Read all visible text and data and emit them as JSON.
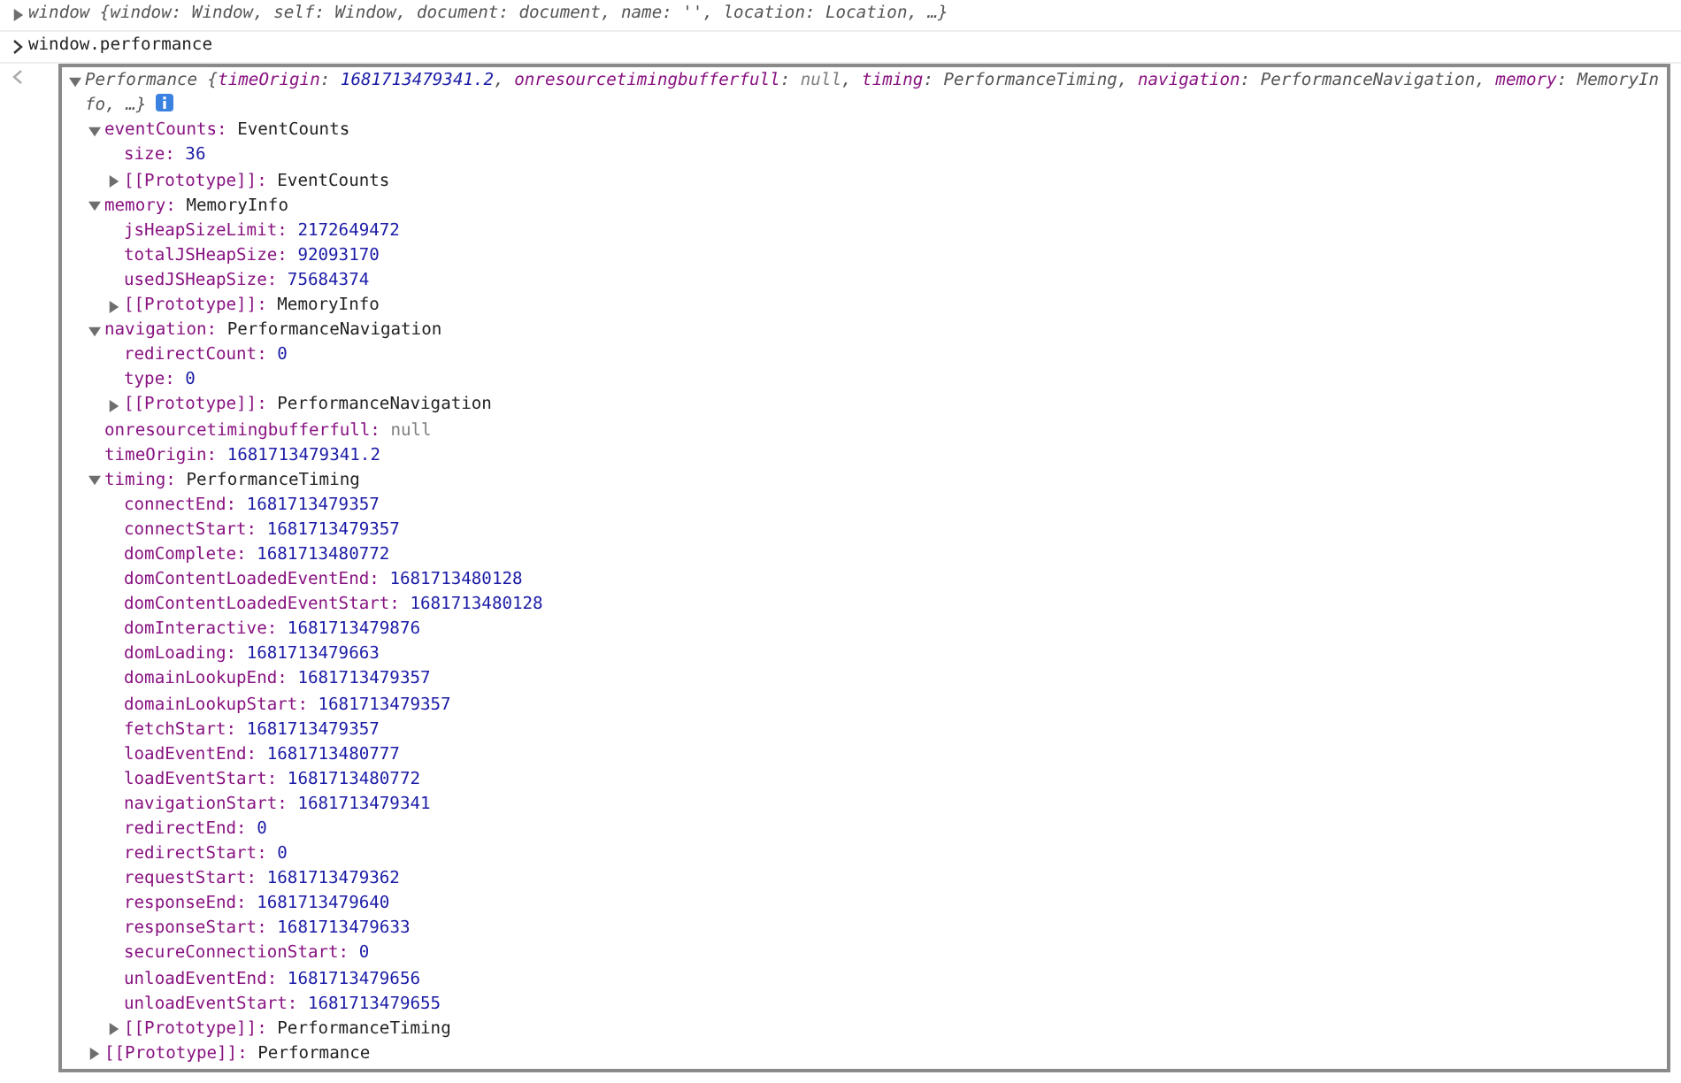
{
  "previous_entry": {
    "text": "window {window: Window, self: Window, document: document, name: '', location: Location, …}",
    "expanded": false
  },
  "input": {
    "text": "window.performance"
  },
  "result": {
    "expanded": true,
    "summary": [
      {
        "text": "Performance {",
        "kind": "plain"
      },
      {
        "text": "timeOrigin",
        "kind": "key"
      },
      {
        "text": ": ",
        "kind": "plain"
      },
      {
        "text": "1681713479341.2",
        "kind": "number"
      },
      {
        "text": ", ",
        "kind": "plain"
      },
      {
        "text": "onresourcetimingbufferfull",
        "kind": "key"
      },
      {
        "text": ": ",
        "kind": "plain"
      },
      {
        "text": "null",
        "kind": "null"
      },
      {
        "text": ", ",
        "kind": "plain"
      },
      {
        "text": "timing",
        "kind": "key"
      },
      {
        "text": ": PerformanceTiming, ",
        "kind": "plain"
      },
      {
        "text": "navigation",
        "kind": "key"
      },
      {
        "text": ": PerformanceNavigation, ",
        "kind": "plain"
      },
      {
        "text": "memory",
        "kind": "key"
      },
      {
        "text": ": MemoryInfo, …}",
        "kind": "plain"
      }
    ],
    "children": [
      {
        "key": "eventCounts:",
        "value": "EventCounts",
        "kind": "object",
        "expanded": true,
        "children": [
          {
            "key": "size:",
            "value": "36",
            "kind": "number"
          },
          {
            "key": "[[Prototype]]:",
            "value": "EventCounts",
            "kind": "object",
            "expanded": false
          }
        ]
      },
      {
        "key": "memory:",
        "value": "MemoryInfo",
        "kind": "object",
        "expanded": true,
        "children": [
          {
            "key": "jsHeapSizeLimit:",
            "value": "2172649472",
            "kind": "number"
          },
          {
            "key": "totalJSHeapSize:",
            "value": "92093170",
            "kind": "number"
          },
          {
            "key": "usedJSHeapSize:",
            "value": "75684374",
            "kind": "number"
          },
          {
            "key": "[[Prototype]]:",
            "value": "MemoryInfo",
            "kind": "object",
            "expanded": false
          }
        ]
      },
      {
        "key": "navigation:",
        "value": "PerformanceNavigation",
        "kind": "object",
        "expanded": true,
        "children": [
          {
            "key": "redirectCount:",
            "value": "0",
            "kind": "number"
          },
          {
            "key": "type:",
            "value": "0",
            "kind": "number"
          },
          {
            "key": "[[Prototype]]:",
            "value": "PerformanceNavigation",
            "kind": "object",
            "expanded": false
          }
        ]
      },
      {
        "key": "onresourcetimingbufferfull:",
        "value": "null",
        "kind": "null"
      },
      {
        "key": "timeOrigin:",
        "value": "1681713479341.2",
        "kind": "number"
      },
      {
        "key": "timing:",
        "value": "PerformanceTiming",
        "kind": "object",
        "expanded": true,
        "children": [
          {
            "key": "connectEnd:",
            "value": "1681713479357",
            "kind": "number"
          },
          {
            "key": "connectStart:",
            "value": "1681713479357",
            "kind": "number"
          },
          {
            "key": "domComplete:",
            "value": "1681713480772",
            "kind": "number"
          },
          {
            "key": "domContentLoadedEventEnd:",
            "value": "1681713480128",
            "kind": "number"
          },
          {
            "key": "domContentLoadedEventStart:",
            "value": "1681713480128",
            "kind": "number"
          },
          {
            "key": "domInteractive:",
            "value": "1681713479876",
            "kind": "number"
          },
          {
            "key": "domLoading:",
            "value": "1681713479663",
            "kind": "number"
          },
          {
            "key": "domainLookupEnd:",
            "value": "1681713479357",
            "kind": "number"
          },
          {
            "key": "domainLookupStart:",
            "value": "1681713479357",
            "kind": "number"
          },
          {
            "key": "fetchStart:",
            "value": "1681713479357",
            "kind": "number"
          },
          {
            "key": "loadEventEnd:",
            "value": "1681713480777",
            "kind": "number"
          },
          {
            "key": "loadEventStart:",
            "value": "1681713480772",
            "kind": "number"
          },
          {
            "key": "navigationStart:",
            "value": "1681713479341",
            "kind": "number"
          },
          {
            "key": "redirectEnd:",
            "value": "0",
            "kind": "number"
          },
          {
            "key": "redirectStart:",
            "value": "0",
            "kind": "number"
          },
          {
            "key": "requestStart:",
            "value": "1681713479362",
            "kind": "number"
          },
          {
            "key": "responseEnd:",
            "value": "1681713479640",
            "kind": "number"
          },
          {
            "key": "responseStart:",
            "value": "1681713479633",
            "kind": "number"
          },
          {
            "key": "secureConnectionStart:",
            "value": "0",
            "kind": "number"
          },
          {
            "key": "unloadEventEnd:",
            "value": "1681713479656",
            "kind": "number"
          },
          {
            "key": "unloadEventStart:",
            "value": "1681713479655",
            "kind": "number"
          },
          {
            "key": "[[Prototype]]:",
            "value": "PerformanceTiming",
            "kind": "object",
            "expanded": false
          }
        ]
      },
      {
        "key": "[[Prototype]]:",
        "value": "Performance",
        "kind": "object",
        "expanded": false
      }
    ]
  }
}
